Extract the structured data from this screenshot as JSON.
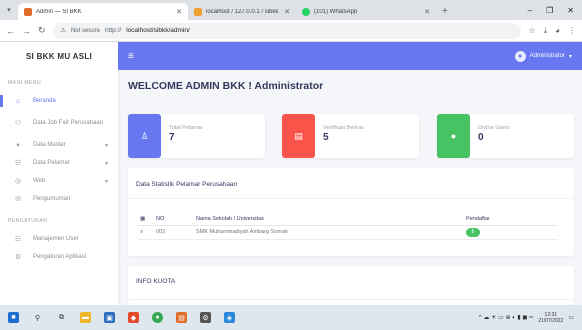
{
  "browser": {
    "tabs": [
      {
        "title": "Admin — SI BKK",
        "favicon_color": "#e06c2c",
        "active": true
      },
      {
        "title": "localhost / 127.0.0.1 / sibkk / ...",
        "favicon_color": "#f0a030",
        "active": false
      },
      {
        "title": "(101) WhatsApp",
        "favicon_color": "#25d366",
        "active": false
      }
    ],
    "new_tab": "+",
    "window_controls": {
      "minimize": "–",
      "maximize": "❐",
      "close": "✕"
    },
    "address": {
      "security_label": "Not secure",
      "url": "localhost/sibkk/admin/",
      "url_prefix": "http://"
    }
  },
  "sidebar": {
    "brand": "SI BKK MU ASLI",
    "sections": [
      {
        "label": "MAIN MENU",
        "items": [
          {
            "label": "Beranda",
            "icon": "home-icon",
            "glyph": "⌂",
            "active": true,
            "caret": false
          },
          {
            "label": "Data Job Fair Perusahaan",
            "icon": "users-icon",
            "glyph": "⚇",
            "active": false,
            "caret": false
          },
          {
            "label": "Data Master",
            "icon": "fire-icon",
            "glyph": "♦",
            "active": false,
            "caret": true
          },
          {
            "label": "Data Pelamar",
            "icon": "group-icon",
            "glyph": "☷",
            "active": false,
            "caret": true
          },
          {
            "label": "Web",
            "icon": "globe-icon",
            "glyph": "◎",
            "active": false,
            "caret": true
          },
          {
            "label": "Pengumuman",
            "icon": "bullhorn-icon",
            "glyph": "✉",
            "active": false,
            "caret": false
          }
        ]
      },
      {
        "label": "PENGATURAN",
        "items": [
          {
            "label": "Manajemen User",
            "icon": "users-cog-icon",
            "glyph": "☷",
            "active": false,
            "caret": false
          },
          {
            "label": "Pengaturan Aplikasi",
            "icon": "gear-icon",
            "glyph": "⚙",
            "active": false,
            "caret": false
          }
        ]
      }
    ]
  },
  "topnav": {
    "menu_glyph": "≡",
    "user_name": "Administrator",
    "user_caret": "▾"
  },
  "main": {
    "title": "WELCOME ADMIN BKK ! Administrator",
    "stats": [
      {
        "label": "Total Pelamar",
        "value": "7",
        "color": "#6777ef",
        "icon": "user-icon",
        "glyph": "♙"
      },
      {
        "label": "Verifikasi Berkas",
        "value": "5",
        "color": "#fc544b",
        "icon": "file-icon",
        "glyph": "▤"
      },
      {
        "label": "Online Users",
        "value": "0",
        "color": "#47c363",
        "icon": "circle-icon",
        "glyph": "●"
      }
    ],
    "statistik": {
      "title": "Data Statistik Pelamar Perusahaan",
      "columns": [
        "",
        "NO",
        "Nama Sekolah / Universitas",
        "Pendaftar"
      ],
      "rows": [
        {
          "handle": "≡",
          "no": "002",
          "name": "SMK Muhammadiyah Ambarg Sonrak",
          "pendaftar": "6"
        }
      ]
    },
    "kuota": {
      "title": "INFO KUOTA"
    }
  },
  "taskbar": {
    "tray_text": "^ ☁ ☀ ▭ ⊕ ◐ ▮ ◼ ═",
    "time": "12:31",
    "date": "21/07/2022"
  }
}
